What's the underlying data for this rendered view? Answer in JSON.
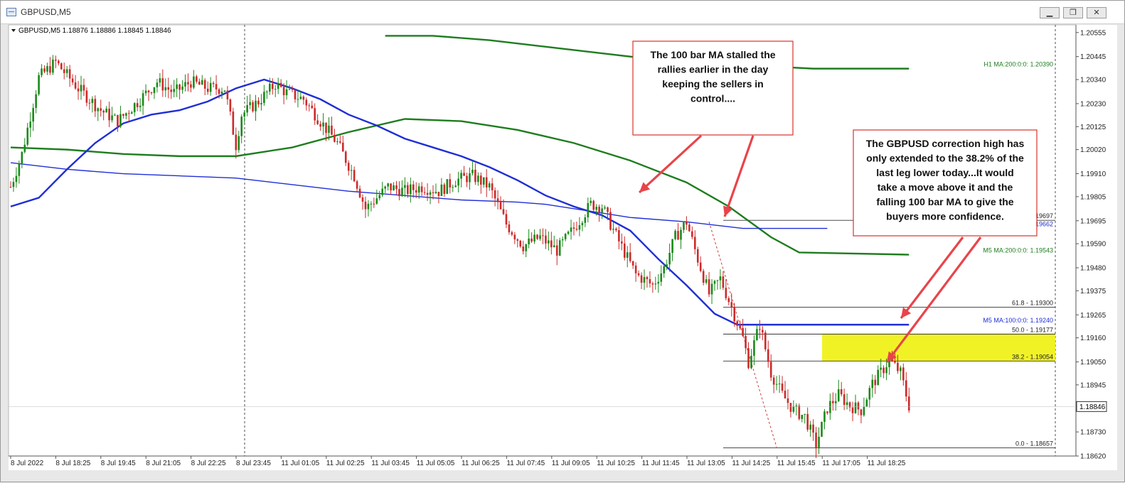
{
  "window": {
    "title": "GBPUSD,M5",
    "buttons": {
      "minimize": "▁",
      "restore": "❐",
      "close": "✕"
    }
  },
  "header": {
    "symbol": "GBPUSD,M5",
    "ohlc": "1.18876 1.18886 1.18845 1.18846"
  },
  "chart_data": {
    "type": "candlestick",
    "symbol": "GBPUSD",
    "timeframe": "M5",
    "ylim": [
      1.1862,
      1.2059
    ],
    "y_ticks": [
      "1.20555",
      "1.20445",
      "1.20340",
      "1.20230",
      "1.20125",
      "1.20020",
      "1.19910",
      "1.19805",
      "1.19695",
      "1.19590",
      "1.19480",
      "1.19375",
      "1.19265",
      "1.19160",
      "1.19050",
      "1.18945",
      "1.18835",
      "1.18730",
      "1.18620"
    ],
    "x_labels": [
      "8 Jul 2022",
      "8 Jul 18:25",
      "8 Jul 19:45",
      "8 Jul 21:05",
      "8 Jul 22:25",
      "8 Jul 23:45",
      "11 Jul 01:05",
      "11 Jul 02:25",
      "11 Jul 03:45",
      "11 Jul 05:05",
      "11 Jul 06:25",
      "11 Jul 07:45",
      "11 Jul 09:05",
      "11 Jul 10:25",
      "11 Jul 11:45",
      "11 Jul 13:05",
      "11 Jul 14:25",
      "11 Jul 15:45",
      "11 Jul 17:05",
      "11 Jul 18:25"
    ],
    "current_price": "1.18846",
    "price_path": [
      [
        0,
        1.1985
      ],
      [
        4,
        1.2
      ],
      [
        10,
        1.2035
      ],
      [
        16,
        1.2042
      ],
      [
        24,
        1.203
      ],
      [
        32,
        1.202
      ],
      [
        38,
        1.2015
      ],
      [
        46,
        1.2025
      ],
      [
        52,
        1.2033
      ],
      [
        58,
        1.2028
      ],
      [
        64,
        1.2033
      ],
      [
        70,
        1.203
      ],
      [
        76,
        1.203
      ],
      [
        80,
        1.2004
      ],
      [
        82,
        1.2018
      ],
      [
        88,
        1.2024
      ],
      [
        94,
        1.2032
      ],
      [
        98,
        1.2028
      ],
      [
        104,
        1.2025
      ],
      [
        110,
        1.2015
      ],
      [
        116,
        1.2005
      ],
      [
        122,
        1.199
      ],
      [
        126,
        1.1975
      ],
      [
        130,
        1.198
      ],
      [
        134,
        1.1985
      ],
      [
        140,
        1.1983
      ],
      [
        146,
        1.1985
      ],
      [
        152,
        1.1983
      ],
      [
        158,
        1.1988
      ],
      [
        164,
        1.199
      ],
      [
        170,
        1.1985
      ],
      [
        176,
        1.1968
      ],
      [
        182,
        1.1958
      ],
      [
        188,
        1.1962
      ],
      [
        194,
        1.1956
      ],
      [
        200,
        1.1966
      ],
      [
        206,
        1.1977
      ],
      [
        210,
        1.1976
      ],
      [
        216,
        1.196
      ],
      [
        222,
        1.1945
      ],
      [
        228,
        1.194
      ],
      [
        232,
        1.1948
      ],
      [
        236,
        1.1962
      ],
      [
        240,
        1.1969
      ],
      [
        244,
        1.1952
      ],
      [
        248,
        1.1936
      ],
      [
        252,
        1.1943
      ],
      [
        256,
        1.193
      ],
      [
        260,
        1.1916
      ],
      [
        262,
        1.1905
      ],
      [
        266,
        1.1922
      ],
      [
        270,
        1.19
      ],
      [
        274,
        1.189
      ],
      [
        278,
        1.1883
      ],
      [
        282,
        1.188
      ],
      [
        286,
        1.1867
      ],
      [
        290,
        1.1884
      ],
      [
        294,
        1.189
      ],
      [
        298,
        1.1885
      ],
      [
        302,
        1.1883
      ],
      [
        306,
        1.1895
      ],
      [
        310,
        1.1902
      ],
      [
        312,
        1.1906
      ],
      [
        316,
        1.19
      ],
      [
        319,
        1.1885
      ]
    ],
    "series": [
      {
        "name": "H1 MA:200:0:0",
        "label_value": "1.20390",
        "color": "#1e7d1e",
        "points": [
          [
            133,
            1.2054
          ],
          [
            150,
            1.2054
          ],
          [
            170,
            1.2052
          ],
          [
            190,
            1.2049
          ],
          [
            210,
            1.2046
          ],
          [
            230,
            1.2043
          ],
          [
            250,
            1.2041
          ],
          [
            270,
            1.204
          ],
          [
            285,
            1.2039
          ],
          [
            319,
            1.2039
          ]
        ]
      },
      {
        "name": "M5 MA:200:0:0",
        "label_value": "1.19543",
        "color": "#1e7d1e",
        "points": [
          [
            0,
            1.2003
          ],
          [
            20,
            1.2002
          ],
          [
            40,
            1.2
          ],
          [
            60,
            1.1999
          ],
          [
            80,
            1.1999
          ],
          [
            100,
            1.2003
          ],
          [
            120,
            1.201
          ],
          [
            140,
            1.2016
          ],
          [
            160,
            1.2015
          ],
          [
            180,
            1.2011
          ],
          [
            200,
            1.2005
          ],
          [
            220,
            1.1997
          ],
          [
            240,
            1.1987
          ],
          [
            255,
            1.1976
          ],
          [
            270,
            1.1962
          ],
          [
            280,
            1.1955
          ],
          [
            319,
            1.1954
          ]
        ]
      },
      {
        "name": "M5 MA:100:0:0",
        "label_value": "1.19240",
        "color": "#1f2ed6",
        "points": [
          [
            0,
            1.1976
          ],
          [
            10,
            1.198
          ],
          [
            20,
            1.1993
          ],
          [
            30,
            1.2005
          ],
          [
            40,
            1.2014
          ],
          [
            50,
            1.2018
          ],
          [
            60,
            1.202
          ],
          [
            70,
            1.2024
          ],
          [
            80,
            1.203
          ],
          [
            90,
            1.2034
          ],
          [
            100,
            1.203
          ],
          [
            110,
            1.2025
          ],
          [
            120,
            1.2018
          ],
          [
            130,
            1.2013
          ],
          [
            140,
            1.2007
          ],
          [
            150,
            1.2003
          ],
          [
            160,
            1.1999
          ],
          [
            170,
            1.1994
          ],
          [
            180,
            1.1988
          ],
          [
            190,
            1.1981
          ],
          [
            200,
            1.1976
          ],
          [
            210,
            1.1972
          ],
          [
            220,
            1.1965
          ],
          [
            230,
            1.1952
          ],
          [
            240,
            1.194
          ],
          [
            250,
            1.1927
          ],
          [
            258,
            1.1922
          ],
          [
            319,
            1.1922
          ]
        ]
      },
      {
        "name": "Blue step line",
        "label_value": "1.19662",
        "color": "#1f2ed6",
        "points": [
          [
            0,
            1.1996
          ],
          [
            20,
            1.1993
          ],
          [
            40,
            1.1991
          ],
          [
            60,
            1.199
          ],
          [
            80,
            1.1989
          ],
          [
            100,
            1.1986
          ],
          [
            120,
            1.1983
          ],
          [
            140,
            1.1981
          ],
          [
            160,
            1.1979
          ],
          [
            180,
            1.1978
          ],
          [
            190,
            1.1977
          ],
          [
            200,
            1.1975
          ],
          [
            210,
            1.1973
          ],
          [
            220,
            1.1971
          ],
          [
            240,
            1.1969
          ],
          [
            260,
            1.1966
          ],
          [
            290,
            1.1966
          ]
        ]
      },
      {
        "name": "Correction line",
        "color": "#c8403a",
        "points": [
          [
            248,
            1.1969
          ],
          [
            272,
            1.1866
          ]
        ]
      }
    ],
    "fibonacci": [
      {
        "label": "61.8 - 1.19300",
        "value": 1.193
      },
      {
        "label": "50.0 - 1.19177",
        "value": 1.19177
      },
      {
        "label": "38.2 - 1.19054",
        "value": 1.19054
      },
      {
        "label": "0.0 - 1.18657",
        "value": 1.18657
      },
      {
        "label": "0.0 - 1.19697",
        "value": 1.19697
      }
    ],
    "annotations": [
      "The 100 bar MA stalled the rallies earlier in the day keeping the sellers in control....",
      "The GBPUSD correction high has only extended to the 38.2% of the last leg lower today...It would take a move above it and the falling 100 bar MA to give the buyers more confidence."
    ],
    "colors": {
      "bull": "#1a8a1a",
      "bear": "#cc2a2a",
      "arrow": "#e8444a",
      "highlight": "#eef000"
    }
  }
}
